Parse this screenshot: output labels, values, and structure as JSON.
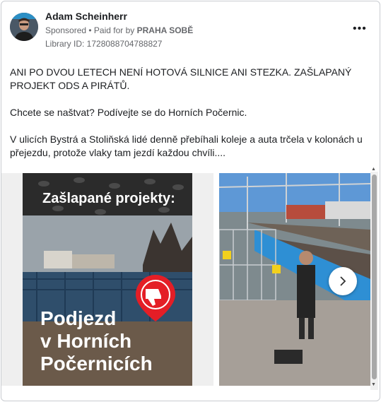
{
  "post": {
    "author": "Adam Scheinherr",
    "sponsored": "Sponsored",
    "paid_for": "• Paid for by",
    "sponsor": "PRAHA SOBĚ",
    "library_id": "Library ID: 1728088704788827",
    "more": "•••",
    "text": [
      "ANI PO DVOU LETECH NENÍ HOTOVÁ SILNICE ANI STEZKA. ZAŠLAPANÝ PROJEKT ODS A PIRÁTŮ.",
      "Chcete se naštvat? Podívejte se do Horních Počernic.",
      "V ulicích Bystrá a Stoliňská lidé denně přebíhali koleje a auta trčela v kolonách u přejezdu, protože vlaky tam jezdí každou chvíli...."
    ]
  },
  "carousel": {
    "card1": {
      "heading": "Zašlapané projekty:",
      "big_line1": "Podjezd",
      "big_line2": "v Horních",
      "big_line3": "Počernicích"
    },
    "next_icon": "chevron-right-icon"
  },
  "colors": {
    "accent_red": "#e41e26",
    "text_gray": "#65676b"
  }
}
